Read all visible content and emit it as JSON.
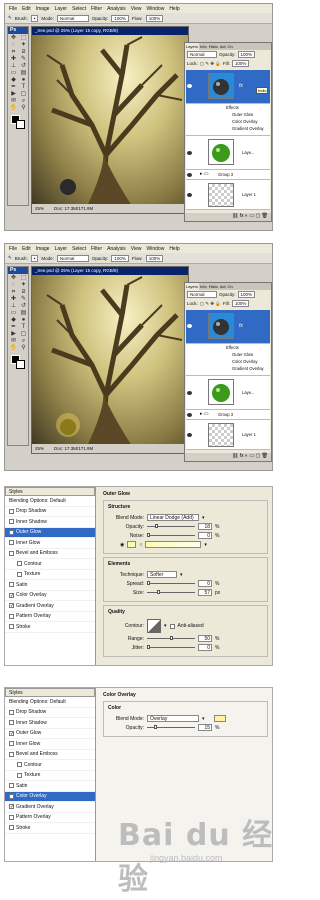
{
  "menu": [
    "File",
    "Edit",
    "Image",
    "Layer",
    "Select",
    "Filter",
    "Analysis",
    "View",
    "Window",
    "Help"
  ],
  "options": {
    "brush_label": "Brush:",
    "mode_label": "Mode:",
    "mode_value": "Normal",
    "opacity_label": "Opacity:",
    "opacity_value": "100%",
    "flow_label": "Flow:",
    "flow_value": "100%"
  },
  "ps_logo": "Ps",
  "doc1": {
    "title": "_tree.psd @ 25% (Layer 15 copy, RGB/8)",
    "zoom": "25%",
    "docsize": "Doc: 17.3M/171.9M"
  },
  "doc2": {
    "title": "_tree.psd @ 25% (Layer 15 copy, RGB/8)",
    "zoom": "25%",
    "docsize": "Doc: 17.3M/171.9M"
  },
  "layers": {
    "tabs": [
      "Layers",
      "Info",
      "Histo",
      "Act",
      "Ch"
    ],
    "blend": "Normal",
    "opacity_label": "Opacity:",
    "opacity_value": "100%",
    "lock_label": "Lock:",
    "fill_label": "Fill:",
    "fill_value": "100%",
    "effects": "Effects",
    "fx1": "Outer Glow",
    "fx2": "Color Overlay",
    "fx3": "Gradient Overlay",
    "layer_a": "Laye...",
    "group": "Group 3",
    "layer_1": "Layer 1",
    "tooltip": "Indic"
  },
  "outer_glow": {
    "styles_header": "Styles",
    "items": [
      {
        "label": "Blending Options: Default",
        "check": false,
        "sub": false,
        "on": false,
        "nobox": true
      },
      {
        "label": "Drop Shadow",
        "check": false,
        "sub": false,
        "on": false
      },
      {
        "label": "Inner Shadow",
        "check": false,
        "sub": false,
        "on": false
      },
      {
        "label": "Outer Glow",
        "check": true,
        "sub": false,
        "on": true
      },
      {
        "label": "Inner Glow",
        "check": false,
        "sub": false,
        "on": false
      },
      {
        "label": "Bevel and Emboss",
        "check": false,
        "sub": false,
        "on": false
      },
      {
        "label": "Contour",
        "check": false,
        "sub": true,
        "on": false
      },
      {
        "label": "Texture",
        "check": false,
        "sub": true,
        "on": false
      },
      {
        "label": "Satin",
        "check": false,
        "sub": false,
        "on": false
      },
      {
        "label": "Color Overlay",
        "check": true,
        "sub": false,
        "on": false
      },
      {
        "label": "Gradient Overlay",
        "check": true,
        "sub": false,
        "on": false
      },
      {
        "label": "Pattern Overlay",
        "check": false,
        "sub": false,
        "on": false
      },
      {
        "label": "Stroke",
        "check": false,
        "sub": false,
        "on": false
      }
    ],
    "title": "Outer Glow",
    "structure": "Structure",
    "blend_label": "Blend Mode:",
    "blend_value": "Linear Dodge (Add)",
    "opacity_label": "Opacity:",
    "opacity_value": "18",
    "opacity_frac": 0.18,
    "noise_label": "Noise:",
    "noise_value": "0",
    "noise_frac": 0,
    "pct": "%",
    "px": "px",
    "elements": "Elements",
    "technique_label": "Technique:",
    "technique_value": "Softer",
    "spread_label": "Spread:",
    "spread_value": "0",
    "spread_frac": 0,
    "size_label": "Size:",
    "size_value": "57",
    "size_frac": 0.23,
    "quality": "Quality",
    "contour_label": "Contour:",
    "antialias_label": "Anti-aliased",
    "range_label": "Range:",
    "range_value": "50",
    "range_frac": 0.5,
    "jitter_label": "Jitter:",
    "jitter_value": "0",
    "jitter_frac": 0,
    "glow_color": "#fffbb0"
  },
  "color_overlay": {
    "styles_header": "Styles",
    "items": [
      {
        "label": "Blending Options: Default",
        "check": false,
        "sub": false,
        "on": false,
        "nobox": true
      },
      {
        "label": "Drop Shadow",
        "check": false,
        "sub": false,
        "on": false
      },
      {
        "label": "Inner Shadow",
        "check": false,
        "sub": false,
        "on": false
      },
      {
        "label": "Outer Glow",
        "check": true,
        "sub": false,
        "on": false
      },
      {
        "label": "Inner Glow",
        "check": false,
        "sub": false,
        "on": false
      },
      {
        "label": "Bevel and Emboss",
        "check": false,
        "sub": false,
        "on": false
      },
      {
        "label": "Contour",
        "check": false,
        "sub": true,
        "on": false
      },
      {
        "label": "Texture",
        "check": false,
        "sub": true,
        "on": false
      },
      {
        "label": "Satin",
        "check": false,
        "sub": false,
        "on": false
      },
      {
        "label": "Color Overlay",
        "check": true,
        "sub": false,
        "on": true
      },
      {
        "label": "Gradient Overlay",
        "check": true,
        "sub": false,
        "on": false
      },
      {
        "label": "Pattern Overlay",
        "check": false,
        "sub": false,
        "on": false
      },
      {
        "label": "Stroke",
        "check": false,
        "sub": false,
        "on": false
      }
    ],
    "title": "Color Overlay",
    "group": "Color",
    "blend_label": "Blend Mode:",
    "blend_value": "Overlay",
    "opacity_label": "Opacity:",
    "opacity_value": "15",
    "opacity_frac": 0.15,
    "pct": "%",
    "swatch": "#fff3a0"
  },
  "watermark": {
    "brand": "Bai du 经验",
    "url": "jingyan.baidu.com"
  },
  "colors": {
    "accent": "#316ac5",
    "title_bar": "#0a246a",
    "panel": "#ece9d8"
  }
}
